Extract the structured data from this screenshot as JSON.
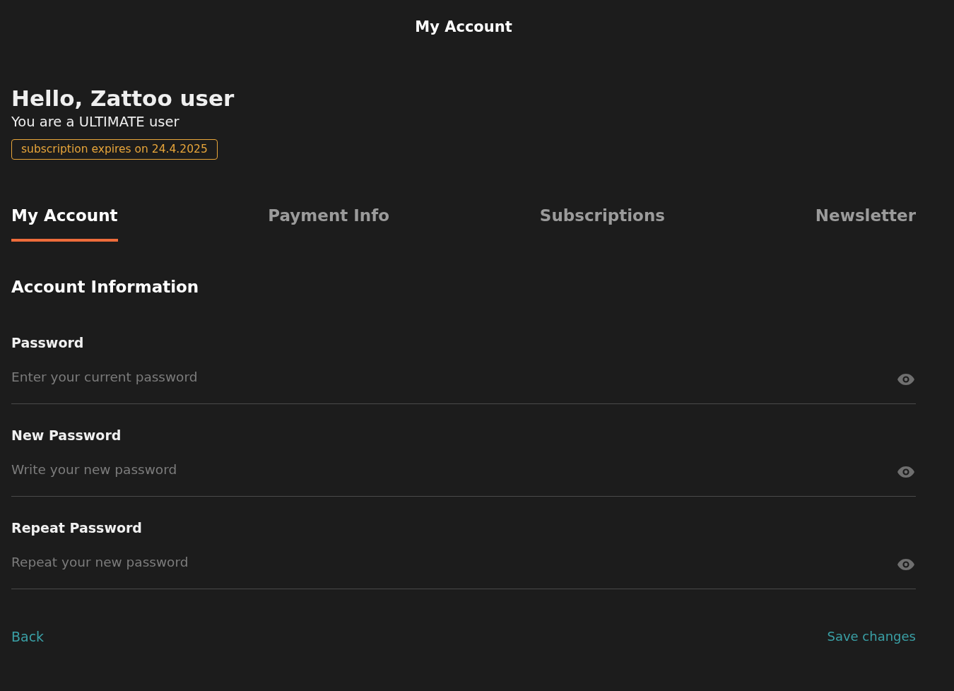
{
  "header": {
    "title": "My Account"
  },
  "greeting": {
    "title": "Hello, Zattoo user",
    "subtitle": "You are a ULTIMATE user",
    "badge": "subscription expires on 24.4.2025"
  },
  "tabs": [
    {
      "label": "My Account",
      "selected": true
    },
    {
      "label": "Payment Info",
      "selected": false
    },
    {
      "label": "Subscriptions",
      "selected": false
    },
    {
      "label": "Newsletter",
      "selected": false
    }
  ],
  "section": {
    "title": "Account Information"
  },
  "fields": [
    {
      "label": "Password",
      "placeholder": "Enter your current password"
    },
    {
      "label": "New Password",
      "placeholder": "Write your new password"
    },
    {
      "label": "Repeat Password",
      "placeholder": "Repeat your new password"
    }
  ],
  "actions": {
    "back": "Back",
    "save": "Save changes"
  }
}
